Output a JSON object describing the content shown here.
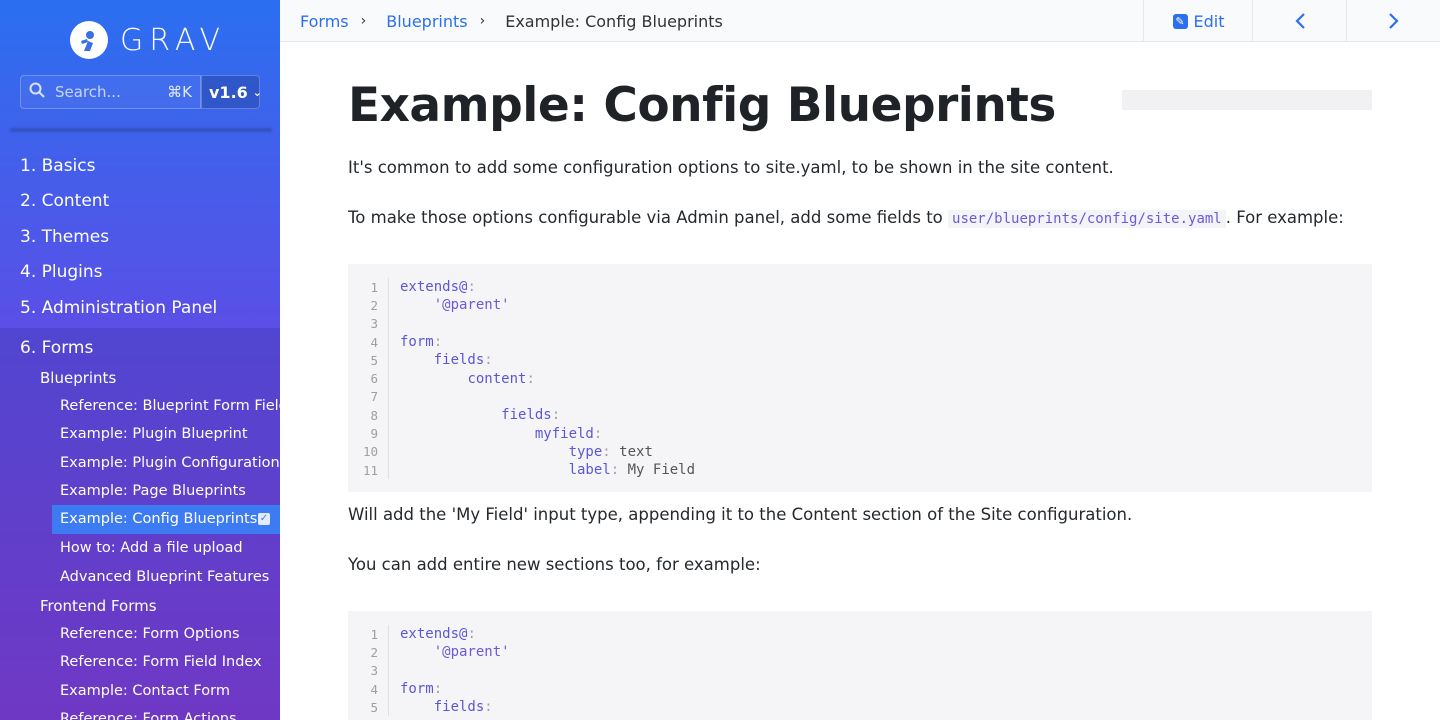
{
  "brand": {
    "name": "GRAV"
  },
  "search": {
    "placeholder": "Search...",
    "shortcut": "⌘K"
  },
  "version": {
    "selected": "v1.6"
  },
  "nav_top": [
    {
      "label": "1. Basics"
    },
    {
      "label": "2. Content"
    },
    {
      "label": "3. Themes"
    },
    {
      "label": "4. Plugins"
    },
    {
      "label": "5. Administration Panel"
    }
  ],
  "nav_forms": {
    "label": "6. Forms",
    "blueprints": {
      "label": "Blueprints",
      "items": [
        {
          "label": "Reference: Blueprint Form Fields"
        },
        {
          "label": "Example: Plugin Blueprint"
        },
        {
          "label": "Example: Plugin Configuration"
        },
        {
          "label": "Example: Page Blueprints"
        },
        {
          "label": "Example: Config Blueprints",
          "active": true
        },
        {
          "label": "How to: Add a file upload"
        },
        {
          "label": "Advanced Blueprint Features"
        }
      ]
    },
    "frontend": {
      "label": "Frontend Forms",
      "items": [
        {
          "label": "Reference: Form Options"
        },
        {
          "label": "Reference: Form Field Index"
        },
        {
          "label": "Example: Contact Form"
        },
        {
          "label": "Reference: Form Actions"
        }
      ]
    }
  },
  "breadcrumb": {
    "items": [
      {
        "label": "Forms"
      },
      {
        "label": "Blueprints"
      }
    ],
    "current": "Example: Config Blueprints"
  },
  "toolbar": {
    "edit_label": "Edit",
    "prev": "‹",
    "next": "›"
  },
  "page": {
    "title": "Example: Config Blueprints",
    "p1": "It's common to add some configuration options to site.yaml, to be shown in the site content.",
    "p2_before": "To make those options configurable via Admin panel, add some fields to ",
    "p2_code": "user/blueprints/config/site.yaml",
    "p2_after": ". For example:",
    "p3": "Will add the 'My Field' input type, appending it to the Content section of the Site configuration.",
    "p4": "You can add entire new sections too, for example:"
  },
  "code1": [
    {
      "n": "1",
      "indent": "",
      "key": "extends@",
      "val": ""
    },
    {
      "n": "2",
      "indent": "    ",
      "key": "",
      "val": "'@parent'"
    },
    {
      "n": "3",
      "indent": "",
      "key": "",
      "val": ""
    },
    {
      "n": "4",
      "indent": "",
      "key": "form",
      "val": ""
    },
    {
      "n": "5",
      "indent": "    ",
      "key": "fields",
      "val": ""
    },
    {
      "n": "6",
      "indent": "        ",
      "key": "content",
      "val": ""
    },
    {
      "n": "7",
      "indent": "",
      "key": "",
      "val": ""
    },
    {
      "n": "8",
      "indent": "            ",
      "key": "fields",
      "val": ""
    },
    {
      "n": "9",
      "indent": "                ",
      "key": "myfield",
      "val": ""
    },
    {
      "n": "10",
      "indent": "                    ",
      "key": "type",
      "val": "text"
    },
    {
      "n": "11",
      "indent": "                    ",
      "key": "label",
      "val": "My Field"
    }
  ],
  "code2": [
    {
      "n": "1",
      "indent": "",
      "key": "extends@",
      "val": ""
    },
    {
      "n": "2",
      "indent": "    ",
      "key": "",
      "val": "'@parent'"
    },
    {
      "n": "3",
      "indent": "",
      "key": "",
      "val": ""
    },
    {
      "n": "4",
      "indent": "",
      "key": "form",
      "val": ""
    },
    {
      "n": "5",
      "indent": "    ",
      "key": "fields",
      "val": ""
    }
  ]
}
